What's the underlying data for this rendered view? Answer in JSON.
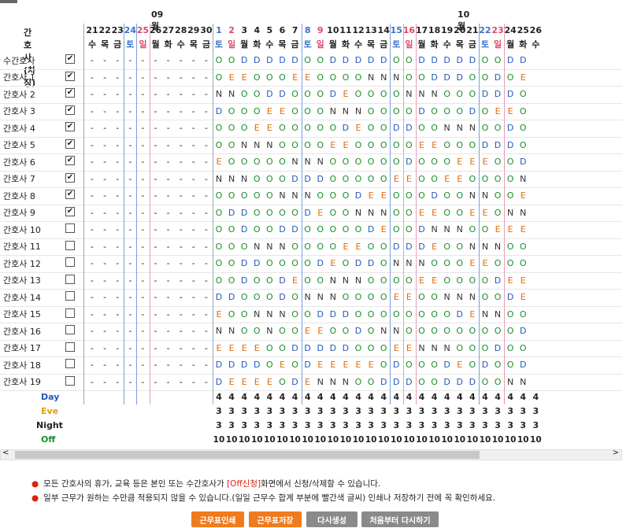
{
  "months": [
    "09월",
    "10월"
  ],
  "header_label": "간호사 (차징)",
  "days": [
    {
      "n": "21",
      "w": "수"
    },
    {
      "n": "22",
      "w": "목"
    },
    {
      "n": "23",
      "w": "금"
    },
    {
      "n": "24",
      "w": "토"
    },
    {
      "n": "25",
      "w": "일"
    },
    {
      "n": "26",
      "w": "월"
    },
    {
      "n": "27",
      "w": "화"
    },
    {
      "n": "28",
      "w": "수"
    },
    {
      "n": "29",
      "w": "목"
    },
    {
      "n": "30",
      "w": "금"
    },
    {
      "n": "1",
      "w": "토"
    },
    {
      "n": "2",
      "w": "일"
    },
    {
      "n": "3",
      "w": "월"
    },
    {
      "n": "4",
      "w": "화"
    },
    {
      "n": "5",
      "w": "수"
    },
    {
      "n": "6",
      "w": "목"
    },
    {
      "n": "7",
      "w": "금"
    },
    {
      "n": "8",
      "w": "토"
    },
    {
      "n": "9",
      "w": "일"
    },
    {
      "n": "10",
      "w": "월"
    },
    {
      "n": "11",
      "w": "화"
    },
    {
      "n": "12",
      "w": "수"
    },
    {
      "n": "13",
      "w": "목"
    },
    {
      "n": "14",
      "w": "금"
    },
    {
      "n": "15",
      "w": "토"
    },
    {
      "n": "16",
      "w": "일"
    },
    {
      "n": "17",
      "w": "월"
    },
    {
      "n": "18",
      "w": "화"
    },
    {
      "n": "19",
      "w": "수"
    },
    {
      "n": "20",
      "w": "목"
    },
    {
      "n": "21",
      "w": "금"
    },
    {
      "n": "22",
      "w": "토"
    },
    {
      "n": "23",
      "w": "일"
    },
    {
      "n": "24",
      "w": "월"
    },
    {
      "n": "25",
      "w": "화"
    },
    {
      "n": "26",
      "w": "수"
    }
  ],
  "nurses": [
    {
      "name": "수간호사",
      "checked": true,
      "s": "OODDDDDOODDDDDOODDDDDOODD"
    },
    {
      "name": "간호사 1",
      "checked": true,
      "s": "OEEOOOEEOOOONNNOODDDOODOE"
    },
    {
      "name": "간호사 2",
      "checked": true,
      "s": "NNOODDOOODEOOOONNNOOODDDO"
    },
    {
      "name": "간호사 3",
      "checked": true,
      "s": "DOOOEEOOONNNOOOODOOODOEEO"
    },
    {
      "name": "간호사 4",
      "checked": true,
      "s": "OOOEEOOOOODEOODDOONNNOODO"
    },
    {
      "name": "간호사 5",
      "checked": true,
      "s": "OONNNOOOOEEOOOOOEEOOODDDO"
    },
    {
      "name": "간호사 6",
      "checked": true,
      "s": "EOOOOONNNOOOOOODOOOEEEOOD"
    },
    {
      "name": "간호사 7",
      "checked": true,
      "s": "NNNOOODDDOOOOOEEOOEEOOOON"
    },
    {
      "name": "간호사 8",
      "checked": true,
      "s": "OOOOONNNOOODEEOOODOONNOOE"
    },
    {
      "name": "간호사 9",
      "checked": true,
      "s": "ODDOOOODEOONNNOOEEOOEEONN"
    },
    {
      "name": "간호사 10",
      "checked": false,
      "s": "OODOODDOOOOODEOODNNNOOEEE"
    },
    {
      "name": "간호사 11",
      "checked": false,
      "s": "OOONNNOOOOEEOODDDEOONNNOO"
    },
    {
      "name": "간호사 12",
      "checked": false,
      "s": "OODDOOOODEODDONNNOOOEEOOO"
    },
    {
      "name": "간호사 13",
      "checked": false,
      "s": "OODOODEOONNNOOOOEEOOOODEE"
    },
    {
      "name": "간호사 14",
      "checked": false,
      "s": "DDOOODONNNOOOOEEOONNNOODE"
    },
    {
      "name": "간호사 15",
      "checked": false,
      "s": "EOONNNOODDDOOOOOOOODENNOO"
    },
    {
      "name": "간호사 16",
      "checked": false,
      "s": "NNOONOOEEOODONNOOOOOOOOOD"
    },
    {
      "name": "간호사 17",
      "checked": false,
      "s": "EEEEOODDDDDOOOEENNNOOODOO"
    },
    {
      "name": "간호사 18",
      "checked": false,
      "s": "DDDDOEODEEEEEODOOODEODOOD"
    },
    {
      "name": "간호사 19",
      "checked": false,
      "s": "DEEEEODENNNOODDDOODDDOONN"
    }
  ],
  "summary": [
    {
      "label": "Day",
      "color": "#2459b8",
      "value": "4"
    },
    {
      "label": "Eve",
      "color": "#e0a100",
      "value": "3"
    },
    {
      "label": "Night",
      "color": "#222222",
      "value": "3"
    },
    {
      "label": "Off",
      "color": "#1a8f2a",
      "value": "10"
    }
  ],
  "scroll": {
    "left": "<",
    "right": ">"
  },
  "notes": [
    {
      "before": "모든 간호사의 휴가, 교육 등은 본인 또는 수간호사가 ",
      "highlight": "[Off신청]",
      "after": "화면에서 신청/삭제할 수 있습니다."
    },
    {
      "before": "일부 근무가 원하는 수만큼 적용되지 않을 수 있습니다.(일일 근무수 합계 부분에 빨간색 글씨) 인쇄나 저장하기 전에 꼭 확인하세요.",
      "highlight": "",
      "after": ""
    }
  ],
  "buttons": {
    "print": "근무표인쇄",
    "save": "근무표저장",
    "regen": "다시생성",
    "restart": "처음부터 다시하기"
  },
  "colors": {
    "orange": "#f07a1e",
    "gray": "#8a8a8a",
    "blue": "#3b73c9",
    "red": "#e0476c"
  }
}
